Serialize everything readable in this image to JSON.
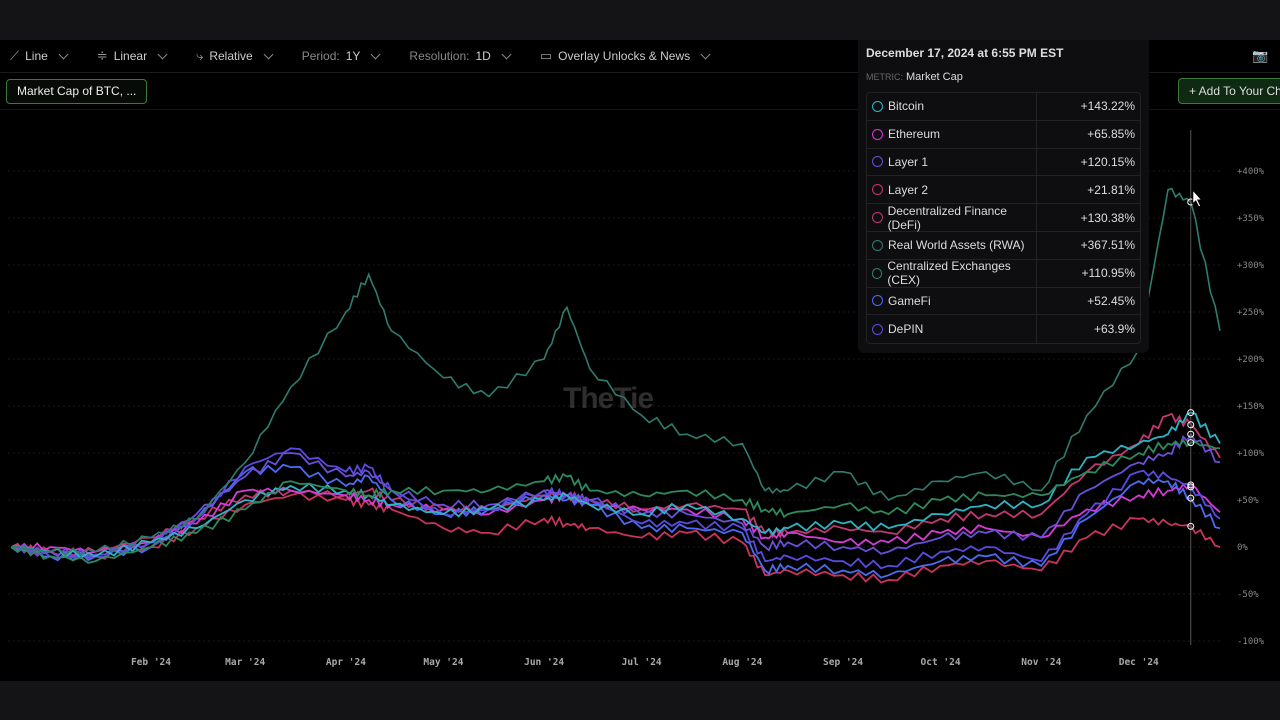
{
  "toolbar": {
    "chart_type": "Line",
    "scale": "Linear",
    "mode": "Relative",
    "period_label": "Period:",
    "period_value": "1Y",
    "resolution_label": "Resolution:",
    "resolution_value": "1D",
    "overlay": "Overlay Unlocks & News"
  },
  "chip": "Market Cap of BTC, ...",
  "add_button": "+ Add To Your Ch",
  "watermark": "TheTie",
  "tooltip": {
    "date": "December 17, 2024 at 6:55 PM EST",
    "metric_key": "METRIC:",
    "metric_value": "Market Cap",
    "rows": [
      {
        "name": "Bitcoin",
        "value": "+143.22%"
      },
      {
        "name": "Ethereum",
        "value": "+65.85%"
      },
      {
        "name": "Layer 1",
        "value": "+120.15%"
      },
      {
        "name": "Layer 2",
        "value": "+21.81%"
      },
      {
        "name": "Decentralized Finance (DeFi)",
        "value": "+130.38%"
      },
      {
        "name": "Real World Assets (RWA)",
        "value": "+367.51%"
      },
      {
        "name": "Centralized Exchanges (CEX)",
        "value": "+110.95%"
      },
      {
        "name": "GameFi",
        "value": "+52.45%"
      },
      {
        "name": "DePIN",
        "value": "+63.9%"
      }
    ]
  },
  "chart_data": {
    "type": "line",
    "ylim": [
      -100,
      420
    ],
    "y_ticks": [
      "-100%",
      "-50%",
      "0%",
      "+50%",
      "+100%",
      "+150%",
      "+200%",
      "+250%",
      "+300%",
      "+350%",
      "+400%"
    ],
    "y_tick_values": [
      -100,
      -50,
      0,
      50,
      100,
      150,
      200,
      250,
      300,
      350,
      400
    ],
    "x_ticks": [
      "Feb '24",
      "Mar '24",
      "Apr '24",
      "May '24",
      "Jun '24",
      "Jul '24",
      "Aug '24",
      "Sep '24",
      "Oct '24",
      "Nov '24",
      "Dec '24"
    ],
    "x_tick_dates": [
      "2024-02-01",
      "2024-03-01",
      "2024-04-01",
      "2024-05-01",
      "2024-06-01",
      "2024-07-01",
      "2024-08-01",
      "2024-09-01",
      "2024-10-01",
      "2024-11-01",
      "2024-12-01"
    ],
    "xlim": [
      "2023-12-19",
      "2024-12-26"
    ],
    "grid": true,
    "crosshair_date": "2024-12-17",
    "x": [
      "2023-12-20",
      "2024-01-01",
      "2024-01-15",
      "2024-02-01",
      "2024-02-15",
      "2024-03-01",
      "2024-03-15",
      "2024-04-01",
      "2024-04-08",
      "2024-04-15",
      "2024-05-01",
      "2024-05-15",
      "2024-06-01",
      "2024-06-08",
      "2024-06-15",
      "2024-07-01",
      "2024-07-15",
      "2024-08-01",
      "2024-08-08",
      "2024-08-15",
      "2024-09-01",
      "2024-09-15",
      "2024-10-01",
      "2024-10-15",
      "2024-11-01",
      "2024-11-15",
      "2024-12-01",
      "2024-12-10",
      "2024-12-17",
      "2024-12-26"
    ],
    "series": [
      {
        "name": "Bitcoin",
        "color": "#2bb5c4",
        "values": [
          0,
          -5,
          -10,
          5,
          20,
          50,
          65,
          60,
          55,
          45,
          35,
          40,
          50,
          55,
          45,
          35,
          45,
          30,
          15,
          20,
          25,
          20,
          35,
          45,
          45,
          95,
          110,
          120,
          143,
          110
        ]
      },
      {
        "name": "Ethereum",
        "color": "#d63bd6",
        "values": [
          0,
          0,
          -5,
          5,
          25,
          60,
          60,
          55,
          50,
          45,
          40,
          35,
          50,
          55,
          45,
          40,
          40,
          30,
          10,
          15,
          5,
          5,
          15,
          20,
          10,
          40,
          55,
          60,
          66,
          37
        ]
      },
      {
        "name": "Layer 1",
        "color": "#6a4fd8",
        "values": [
          0,
          -5,
          -8,
          5,
          35,
          75,
          100,
          75,
          80,
          60,
          45,
          45,
          60,
          55,
          50,
          35,
          35,
          25,
          0,
          5,
          0,
          -5,
          10,
          15,
          10,
          60,
          90,
          100,
          120,
          90
        ]
      },
      {
        "name": "Layer 2",
        "color": "#c9345c",
        "values": [
          0,
          -5,
          -10,
          0,
          20,
          45,
          55,
          50,
          45,
          40,
          20,
          15,
          30,
          25,
          20,
          10,
          15,
          5,
          -30,
          -25,
          -30,
          -35,
          -20,
          -15,
          -25,
          10,
          30,
          25,
          22,
          0
        ]
      },
      {
        "name": "Decentralized Finance (DeFi)",
        "color": "#c2386f",
        "values": [
          0,
          -5,
          -5,
          10,
          30,
          55,
          60,
          55,
          60,
          50,
          40,
          40,
          55,
          55,
          50,
          40,
          45,
          40,
          15,
          15,
          20,
          15,
          30,
          35,
          35,
          80,
          110,
          140,
          130,
          95
        ]
      },
      {
        "name": "Real World Assets (RWA)",
        "color": "#2f7d6e",
        "values": [
          0,
          -5,
          -5,
          10,
          30,
          90,
          170,
          250,
          290,
          230,
          180,
          160,
          200,
          255,
          190,
          140,
          120,
          110,
          60,
          60,
          80,
          50,
          70,
          80,
          60,
          140,
          210,
          380,
          367,
          230
        ]
      },
      {
        "name": "Centralized Exchanges (CEX)",
        "color": "#2e8a5e",
        "values": [
          0,
          -10,
          -15,
          0,
          15,
          40,
          70,
          60,
          55,
          60,
          60,
          60,
          70,
          75,
          60,
          55,
          60,
          50,
          40,
          35,
          45,
          35,
          50,
          55,
          55,
          80,
          100,
          110,
          111,
          105
        ]
      },
      {
        "name": "GameFi",
        "color": "#4b6cf0",
        "values": [
          0,
          -10,
          -10,
          0,
          30,
          80,
          85,
          65,
          75,
          50,
          35,
          40,
          55,
          50,
          45,
          20,
          20,
          15,
          -25,
          -20,
          -25,
          -30,
          -15,
          -10,
          -20,
          30,
          70,
          70,
          52,
          20
        ]
      },
      {
        "name": "DePIN",
        "color": "#5b4be0",
        "values": [
          0,
          -10,
          -10,
          5,
          30,
          85,
          105,
          80,
          85,
          60,
          35,
          40,
          60,
          55,
          50,
          25,
          25,
          20,
          -15,
          -10,
          -15,
          -20,
          -5,
          0,
          -15,
          35,
          80,
          75,
          64,
          30
        ]
      }
    ]
  }
}
